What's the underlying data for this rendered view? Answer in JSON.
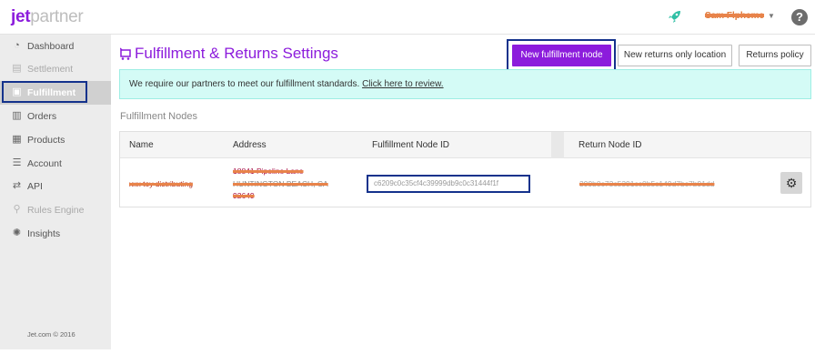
{
  "header": {
    "logo_jet": "jet",
    "logo_partner": "partner",
    "user_name": "Sam Flpheme",
    "help_label": "?"
  },
  "sidebar": {
    "items": [
      {
        "label": "Dashboard",
        "icon": "dashboard-icon",
        "state": "normal"
      },
      {
        "label": "Settlement",
        "icon": "settlement-icon",
        "state": "disabled"
      },
      {
        "label": "Fulfillment",
        "icon": "cart-icon",
        "state": "active"
      },
      {
        "label": "Orders",
        "icon": "orders-icon",
        "state": "normal"
      },
      {
        "label": "Products",
        "icon": "products-icon",
        "state": "normal"
      },
      {
        "label": "Account",
        "icon": "sliders-icon",
        "state": "normal"
      },
      {
        "label": "API",
        "icon": "api-icon",
        "state": "normal"
      },
      {
        "label": "Rules Engine",
        "icon": "rules-icon",
        "state": "disabled"
      },
      {
        "label": "Insights",
        "icon": "lightbulb-icon",
        "state": "normal"
      }
    ],
    "copyright": "Jet.com © 2016"
  },
  "main": {
    "title": "Fulfillment & Returns Settings",
    "buttons": {
      "new_node": "New fulfillment node",
      "new_returns": "New returns only location",
      "returns_policy": "Returns policy"
    },
    "notice": {
      "text": "We require our partners to meet our fulfillment standards.",
      "link": "Click here to review."
    },
    "section_label": "Fulfillment Nodes",
    "table": {
      "headers": [
        "Name",
        "Address",
        "Fulfillment Node ID",
        "Return Node ID"
      ],
      "rows": [
        {
          "name": "xxx toy distributing",
          "address_line1": "18841 Pipeline Lane",
          "address_line2": "HUNTINGTON BEACH, CA",
          "address_line3": "92649",
          "node_id": "c6209c0c35cf4c39999db9c0c31444f1f",
          "return_node_id": "399b0c73c5391cc0b5c149d7bc7b91dd"
        }
      ]
    }
  },
  "colors": {
    "brand_purple": "#8c1cdc",
    "highlight_outline": "#14328c",
    "notice_bg": "#d4fbf6",
    "redaction": "#e8834a"
  }
}
